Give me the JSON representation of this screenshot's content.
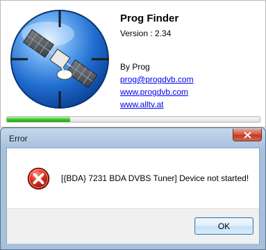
{
  "splash": {
    "app_name": "Prog Finder",
    "version": "Version : 2.34",
    "by": "By Prog",
    "links": [
      "prog@progdvb.com",
      "www.progdvb.com",
      "www.alltv.at"
    ],
    "logo_icon": "satellite-globe-icon",
    "progress_percent": 25,
    "progress_color": "#38c726"
  },
  "dialog": {
    "title": "Error",
    "close_icon": "close-icon",
    "message": "[{BDA} 7231 BDA DVBS Tuner] Device not started!",
    "error_icon": "error-x-icon",
    "ok_label": "OK",
    "close_button_color": "#c23a23"
  }
}
